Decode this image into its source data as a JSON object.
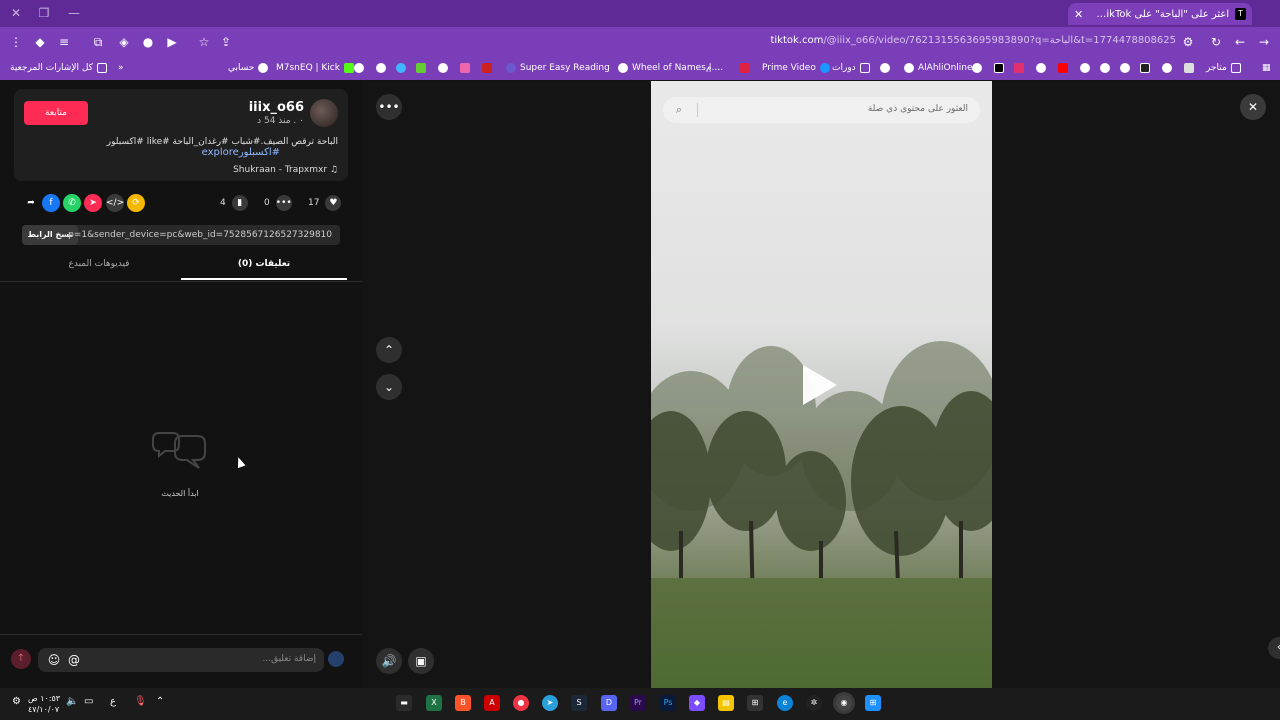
{
  "browser": {
    "tab_title": "اعثر على \"الباحة\" على TikTok | بحـ",
    "tab_favicon": "T",
    "url_host": "tiktok.com",
    "url_rest": "/@iiix_o66/video/7621315563695983890?q=الباحة&t=1774478808625",
    "bookmarks": [
      {
        "label": "كل الإشارات المرجعية",
        "icon": "folder-icon"
      },
      {
        "label": "حسابي",
        "icon": "globe-icon"
      },
      {
        "label": "M7snEQ | Kick",
        "icon": "kick-icon"
      },
      {
        "label": "Super Easy Reading",
        "icon": "globe-icon"
      },
      {
        "label": "Wheel of Names | ...",
        "icon": "globe-icon"
      },
      {
        "label": "م...",
        "icon": "globe-icon"
      },
      {
        "label": "Prime Video",
        "icon": "prime-icon"
      },
      {
        "label": "دورات",
        "icon": "folder-icon"
      },
      {
        "label": "AlAhliOnline",
        "icon": "globe-icon"
      },
      {
        "label": "متاجر",
        "icon": "folder-icon"
      }
    ],
    "accent": "#7a3fb8"
  },
  "post": {
    "follow_label": "متابعة",
    "username": "iiix_o66",
    "posted": "٠ . منذ 54 د",
    "caption": "الباحة ترقص الصيف.#شباب #رغدان_الباحة #like #اكسبلور",
    "hashtags": "#اكسبلورexplore",
    "music": "Shukraan - Trapxmxr",
    "likes": "17",
    "comments": "0",
    "saves": "4",
    "link": "...p=1&sender_device=pc&web_id=7528567126527329810",
    "copy_link_label": "نسخ الرابط"
  },
  "panel_tabs": {
    "comments": "تعليقات (0)",
    "creator_videos": "فيديوهات المبدع"
  },
  "empty_state": {
    "text": "ابدأ الحديث"
  },
  "composer": {
    "placeholder": "إضافة تعليق...",
    "mention_icon": "@"
  },
  "video": {
    "search_placeholder": "العثور على محتوى ذي صلة"
  },
  "taskbar": {
    "time": "١٠:٥٣ ص",
    "date": "٤٧/١٠/٠٧",
    "lang": "ع"
  },
  "colors": {
    "follow": "#fe2c55",
    "hashtag": "#8eb8ff"
  }
}
